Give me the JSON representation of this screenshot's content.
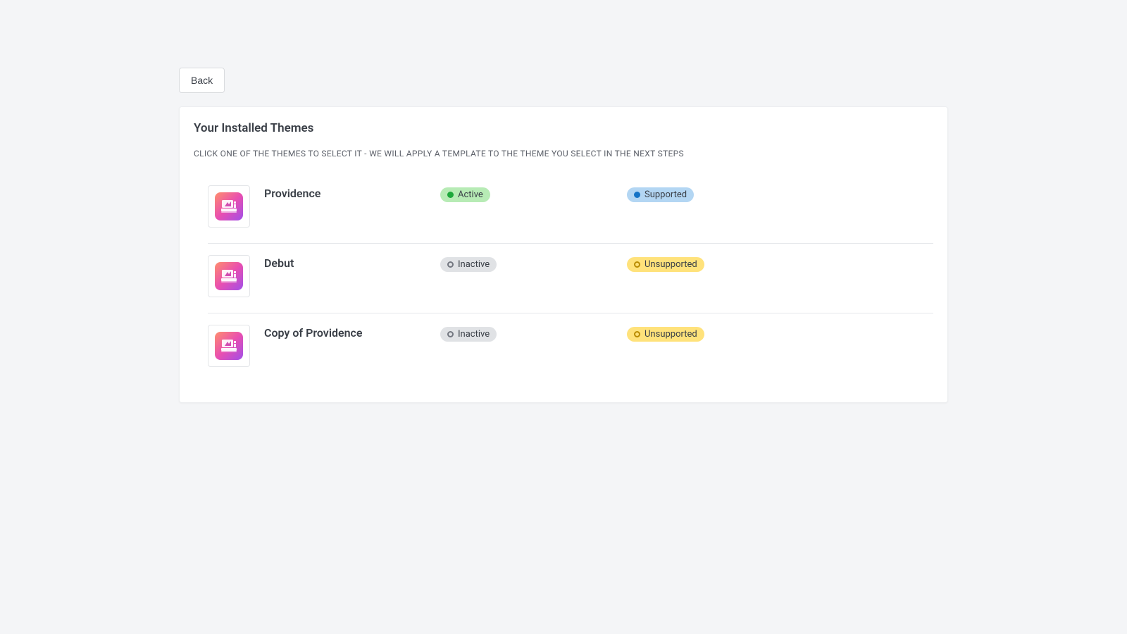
{
  "back_label": "Back",
  "title": "Your Installed Themes",
  "subtitle": "CLICK ONE OF THE THEMES TO SELECT IT - WE WILL APPLY A TEMPLATE TO THE THEME YOU SELECT IN THE NEXT STEPS",
  "status_labels": {
    "active": "Active",
    "inactive": "Inactive"
  },
  "support_labels": {
    "supported": "Supported",
    "unsupported": "Unsupported"
  },
  "themes": [
    {
      "name": "Providence",
      "status": "active",
      "support": "supported"
    },
    {
      "name": "Debut",
      "status": "inactive",
      "support": "unsupported"
    },
    {
      "name": "Copy of Providence",
      "status": "inactive",
      "support": "unsupported"
    }
  ]
}
